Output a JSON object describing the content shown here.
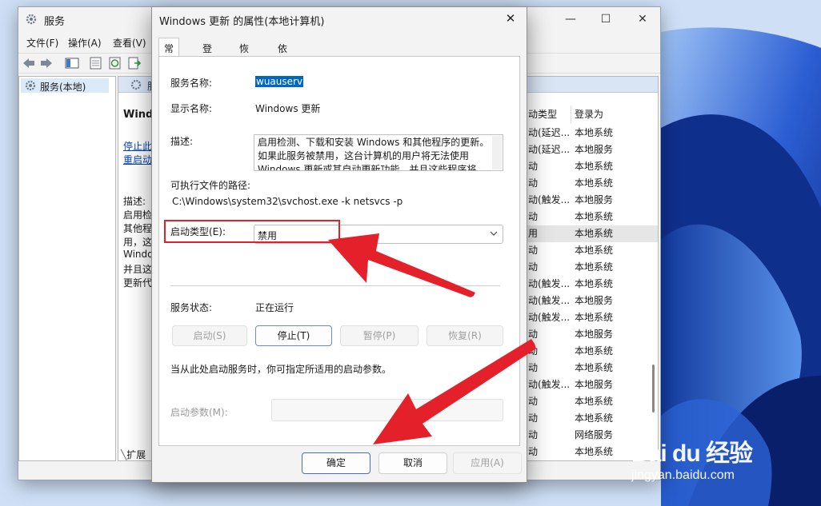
{
  "services_window": {
    "title": "服务",
    "menu": [
      "文件(F)",
      "操作(A)",
      "查看(V)"
    ],
    "tree_item": "服务(本地)",
    "header_short": "服",
    "left_desc": {
      "title": "Windo",
      "stop_link": "停止此",
      "restart_link": "重启动",
      "desc_label": "描述:",
      "lines": [
        "启用检",
        "其他程",
        "用，这",
        "Windo",
        "并且这",
        "更新代"
      ]
    },
    "columns": {
      "startup_type": "动类型",
      "logon_as": "登录为"
    },
    "rows": [
      {
        "startup": "动(延迟...",
        "logon": "本地系统"
      },
      {
        "startup": "动(延迟...",
        "logon": "本地服务"
      },
      {
        "startup": "动",
        "logon": "本地系统"
      },
      {
        "startup": "动",
        "logon": "本地系统"
      },
      {
        "startup": "动(触发...",
        "logon": "本地服务"
      },
      {
        "startup": "动",
        "logon": "本地系统"
      },
      {
        "startup": "用",
        "logon": "本地系统"
      },
      {
        "startup": "动",
        "logon": "本地系统"
      },
      {
        "startup": "动",
        "logon": "本地系统"
      },
      {
        "startup": "动(触发...",
        "logon": "本地系统"
      },
      {
        "startup": "动(触发...",
        "logon": "本地服务"
      },
      {
        "startup": "动(触发...",
        "logon": "本地系统"
      },
      {
        "startup": "动",
        "logon": "本地服务"
      },
      {
        "startup": "动",
        "logon": "本地系统"
      },
      {
        "startup": "动",
        "logon": "本地系统"
      },
      {
        "startup": "动(触发...",
        "logon": "本地服务"
      },
      {
        "startup": "动",
        "logon": "本地系统"
      },
      {
        "startup": "动",
        "logon": "本地系统"
      },
      {
        "startup": "动",
        "logon": "网络服务"
      },
      {
        "startup": "动",
        "logon": "本地系统"
      }
    ],
    "bottom_tab": "扩展"
  },
  "dialog": {
    "title": "Windows 更新 的属性(本地计算机)",
    "close_glyph": "✕",
    "tabs": [
      "常规",
      "登录",
      "恢复",
      "依存关系"
    ],
    "service_name_label": "服务名称:",
    "service_name": "wuauserv",
    "display_name_label": "显示名称:",
    "display_name": "Windows 更新",
    "description_label": "描述:",
    "description": "启用检测、下载和安装 Windows 和其他程序的更新。如果此服务被禁用，这台计算机的用户将无法使用 Windows 更新或其自动更新功能，并且这些程序将",
    "exe_path_label": "可执行文件的路径:",
    "exe_path": "C:\\Windows\\system32\\svchost.exe -k netsvcs -p",
    "startup_type_label": "启动类型(E):",
    "startup_type_value": "禁用",
    "service_status_label": "服务状态:",
    "service_status": "正在运行",
    "buttons": {
      "start": "启动(S)",
      "stop": "停止(T)",
      "pause": "暂停(P)",
      "resume": "恢复(R)"
    },
    "hint": "当从此处启动服务时，你可指定所适用的启动参数。",
    "start_params_label": "启动参数(M):",
    "footer": {
      "ok": "确定",
      "cancel": "取消",
      "apply": "应用(A)"
    }
  },
  "watermark": {
    "brand": "Bai du 经验",
    "url": "jingyan.baidu.com"
  },
  "colors": {
    "accent": "#0067c0",
    "annotation": "#e0202a",
    "wallpaper": "#1c3fa8"
  }
}
